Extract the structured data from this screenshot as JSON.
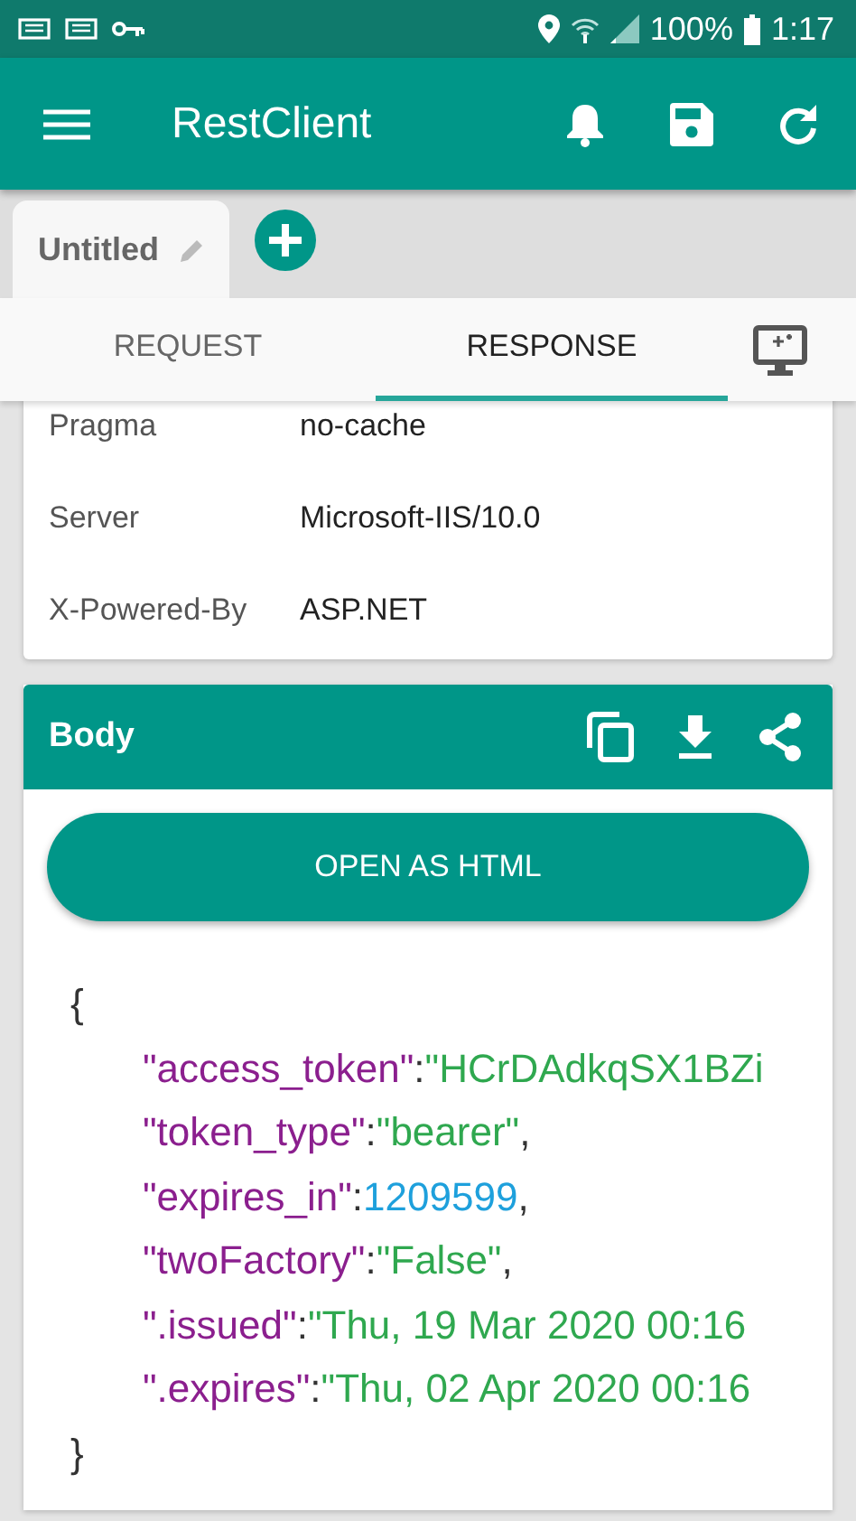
{
  "status_bar": {
    "battery": "100%",
    "time": "1:17"
  },
  "app_bar": {
    "title": "RestClient"
  },
  "doc_tabs": [
    {
      "label": "Untitled",
      "selected": true
    }
  ],
  "tabs": [
    {
      "label": "REQUEST",
      "selected": false
    },
    {
      "label": "RESPONSE",
      "selected": true
    }
  ],
  "headers": [
    {
      "name": "Pragma",
      "value": "no-cache"
    },
    {
      "name": "Server",
      "value": "Microsoft-IIS/10.0"
    },
    {
      "name": "X-Powered-By",
      "value": "ASP.NET"
    }
  ],
  "body": {
    "title": "Body",
    "button": "OPEN AS HTML",
    "open": "{",
    "close": "}",
    "lines": [
      {
        "key": "\"access_token\"",
        "sep": ":",
        "value": "\"HCrDAdkqSX1BZi",
        "kind": "string"
      },
      {
        "key": "\"token_type\"",
        "sep": ":",
        "value": "\"bearer\"",
        "kind": "string",
        "suffix": ","
      },
      {
        "key": "\"expires_in\"",
        "sep": ":",
        "value": "1209599",
        "kind": "number",
        "suffix": ","
      },
      {
        "key": "\"twoFactory\"",
        "sep": ":",
        "value": "\"False\"",
        "kind": "string",
        "suffix": ","
      },
      {
        "key": "\".issued\"",
        "sep": ":",
        "value": "\"Thu, 19 Mar 2020 00:16",
        "kind": "string"
      },
      {
        "key": "\".expires\"",
        "sep": ":",
        "value": "\"Thu, 02 Apr 2020 00:16",
        "kind": "string"
      }
    ]
  }
}
